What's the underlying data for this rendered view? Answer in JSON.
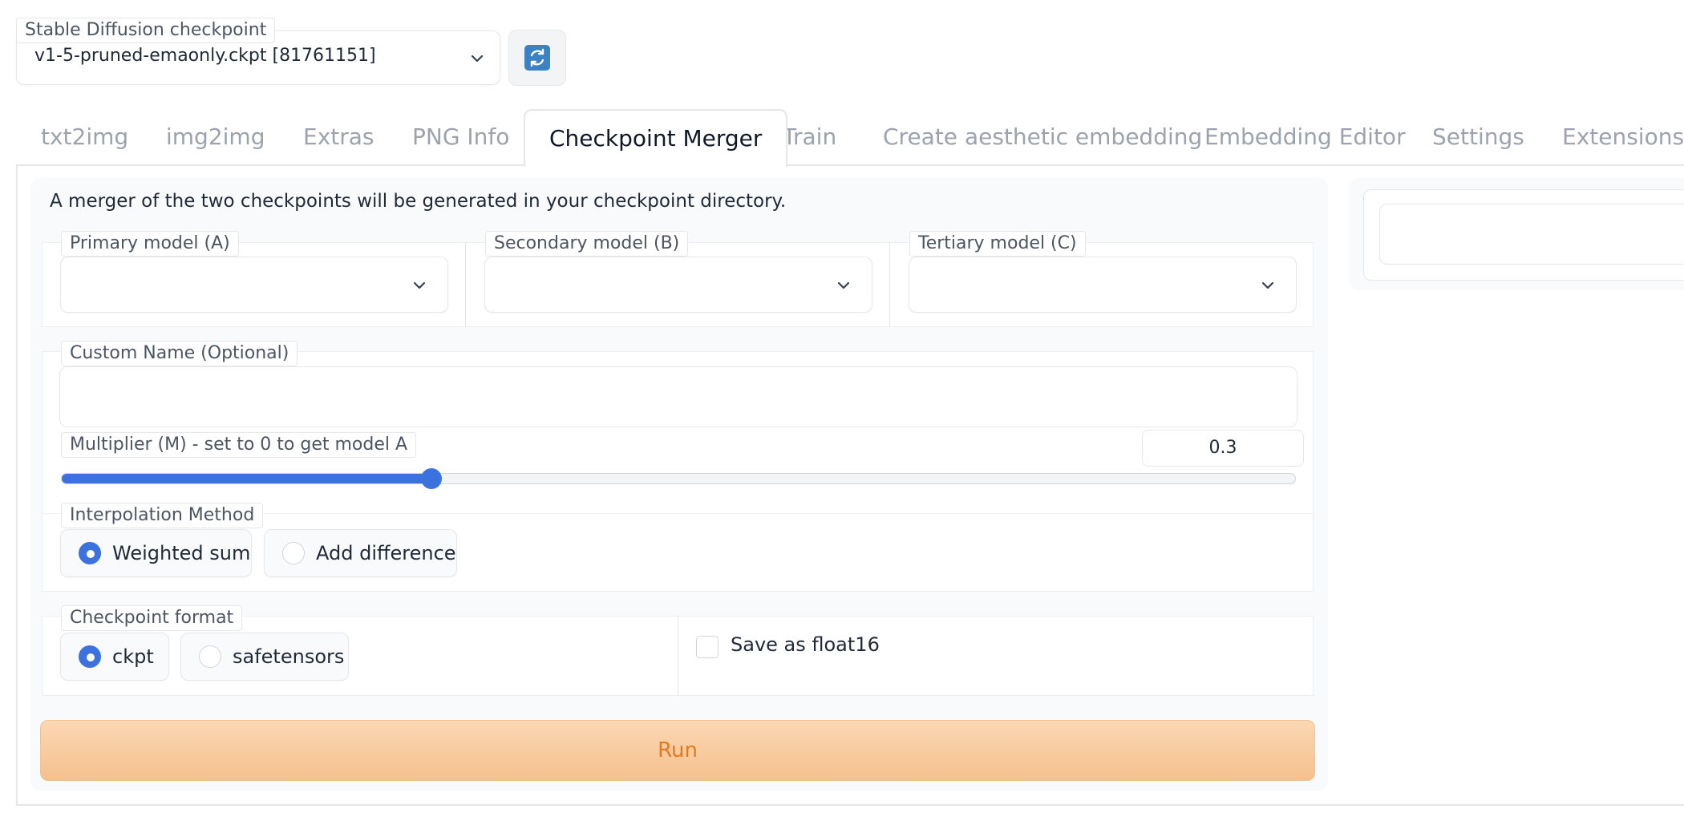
{
  "checkpoint": {
    "label": "Stable Diffusion checkpoint",
    "value": "v1-5-pruned-emaonly.ckpt [81761151]"
  },
  "tabs": [
    {
      "label": "txt2img"
    },
    {
      "label": "img2img"
    },
    {
      "label": "Extras"
    },
    {
      "label": "PNG Info"
    },
    {
      "label": "Checkpoint Merger"
    },
    {
      "label": "Train"
    },
    {
      "label": "Create aesthetic embedding"
    },
    {
      "label": "Embedding Editor"
    },
    {
      "label": "Settings"
    },
    {
      "label": "Extensions"
    }
  ],
  "active_tab": "Checkpoint Merger",
  "merger": {
    "description": "A merger of the two checkpoints will be generated in your checkpoint directory.",
    "primary_label": "Primary model (A)",
    "primary_value": "",
    "secondary_label": "Secondary model (B)",
    "secondary_value": "",
    "tertiary_label": "Tertiary model (C)",
    "tertiary_value": "",
    "custom_name_label": "Custom Name (Optional)",
    "custom_name_value": "",
    "multiplier_label": "Multiplier (M) - set to 0 to get model A",
    "multiplier_value": "0.3",
    "multiplier_min": 0,
    "multiplier_max": 1,
    "interp_label": "Interpolation Method",
    "interp_options": [
      "Weighted sum",
      "Add difference"
    ],
    "interp_selected": "Weighted sum",
    "format_label": "Checkpoint format",
    "format_options": [
      "ckpt",
      "safetensors"
    ],
    "format_selected": "ckpt",
    "float16_label": "Save as float16",
    "float16_checked": false,
    "run_label": "Run"
  },
  "colors": {
    "accent": "#3b72e0",
    "run_text": "#e07b22",
    "run_bg": "#f6c08e"
  }
}
